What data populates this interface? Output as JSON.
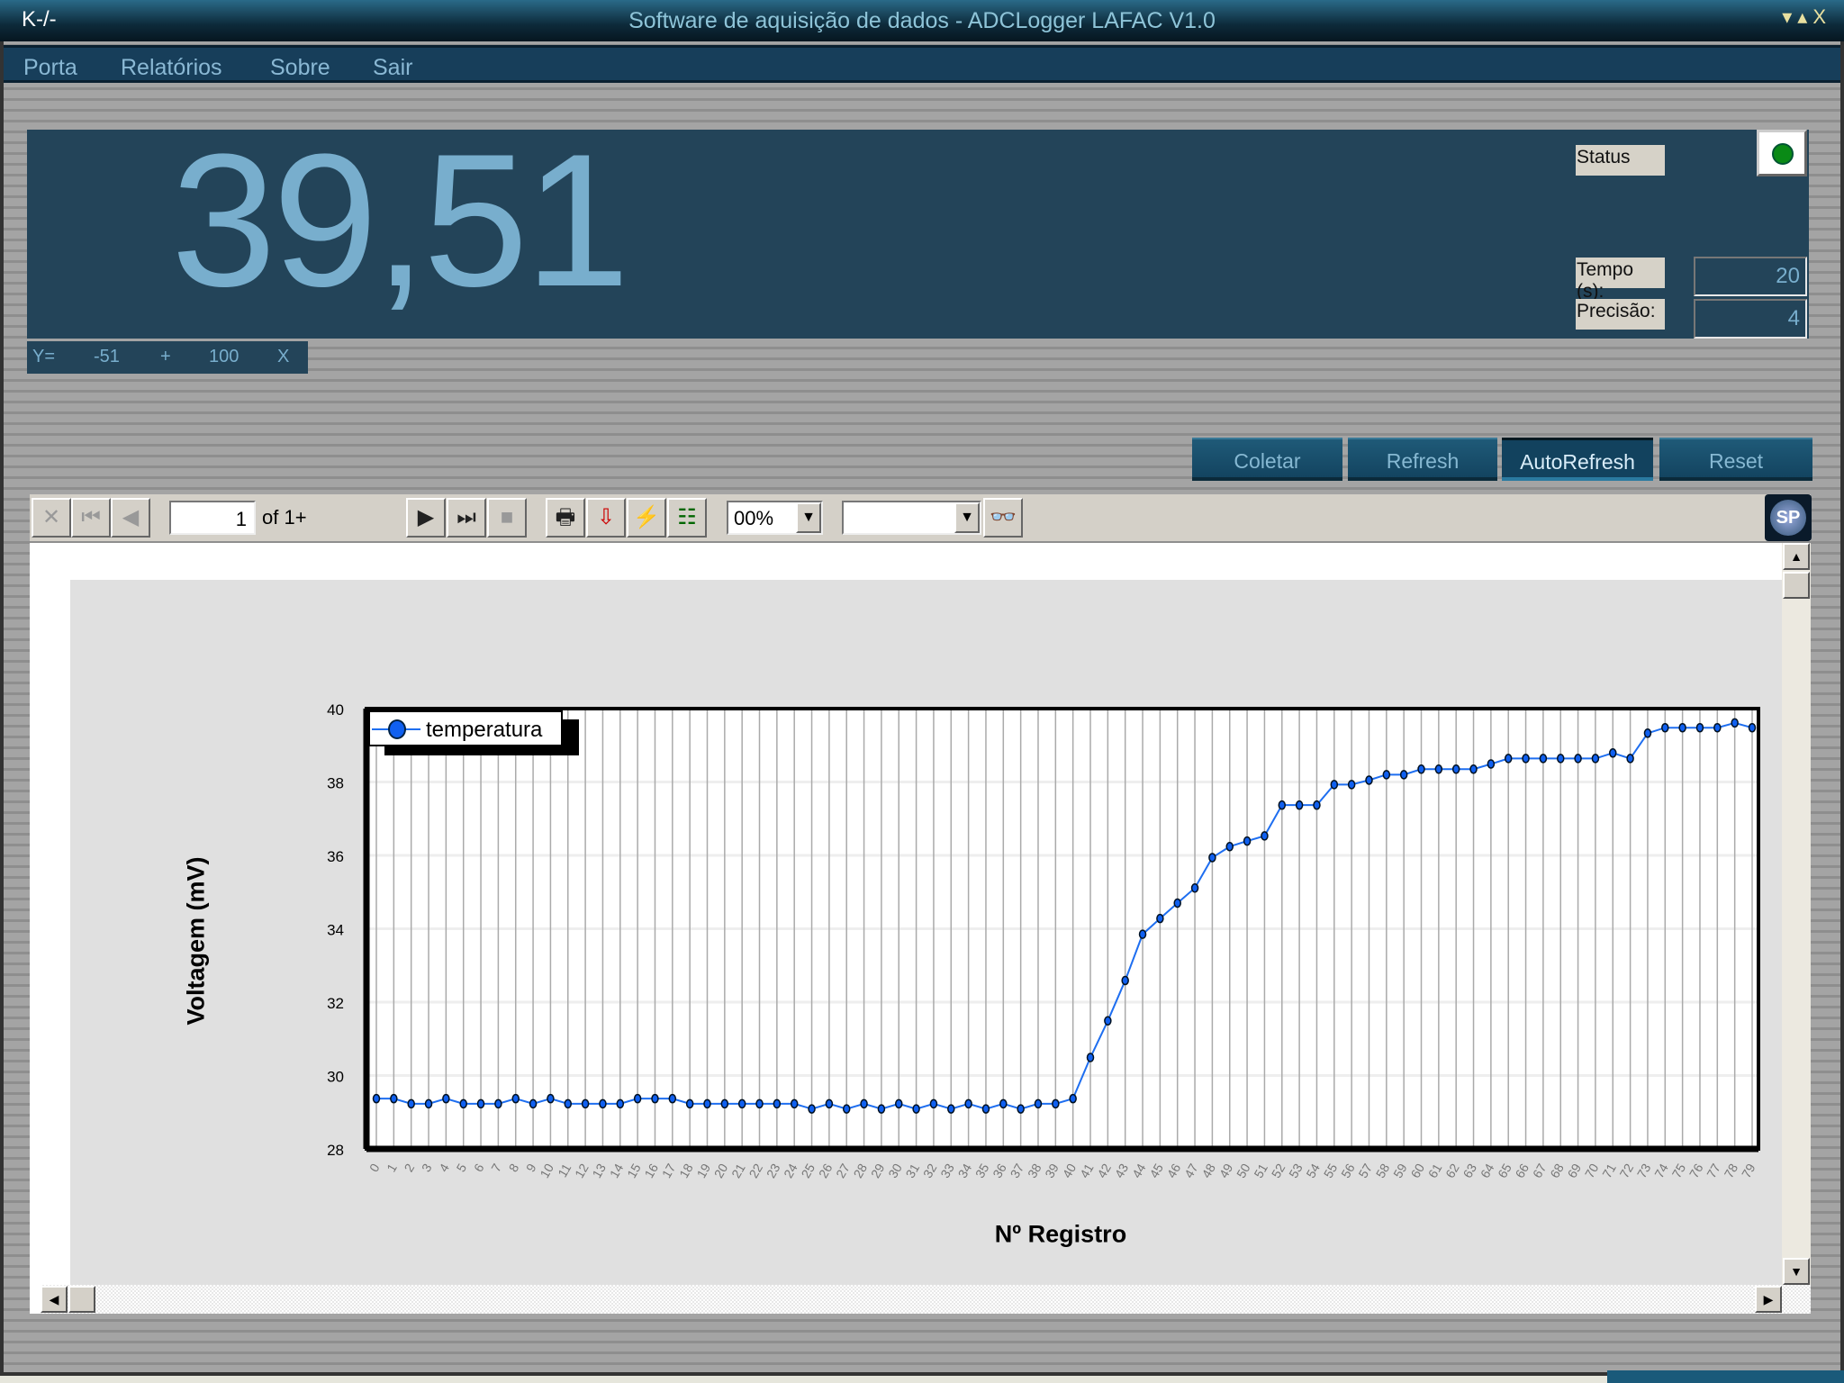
{
  "window": {
    "title": "Software de aquisição de dados - ADCLogger LAFAC V1.0",
    "app_icon": "K-/-",
    "controls": [
      "▾",
      "▴",
      "X"
    ]
  },
  "menu": [
    "Porta",
    "Relatórios",
    "Sobre",
    "Sair"
  ],
  "display": {
    "value": "39,51",
    "status_label": "Status",
    "status_color": "#0a8a16",
    "tempo_label": "Tempo (s):",
    "tempo_value": "20",
    "precisao_label": "Precisão:",
    "precisao_value": "4"
  },
  "formula": {
    "y": "Y=",
    "a": "-51",
    "op": "+",
    "b": "100",
    "x": "X"
  },
  "buttons": {
    "coletar": "Coletar",
    "refresh": "Refresh",
    "autorefresh": "AutoRefresh",
    "reset": "Reset"
  },
  "toolbar": {
    "page": "1",
    "of_pages": "of 1+",
    "zoom": "00%",
    "search": ""
  },
  "colors": {
    "panel": "#234459",
    "accent": "#78aecd",
    "series": "#1e6ef0"
  },
  "chart_data": {
    "type": "line",
    "xlabel": "Nº Registro",
    "ylabel": "Voltagem (mV)",
    "ylim": [
      28,
      40
    ],
    "yticks": [
      28,
      30,
      32,
      34,
      36,
      38,
      40
    ],
    "grid": "vertical lines per record, light horizontal lines per y tick",
    "legend_position": "top-left",
    "x": [
      0,
      1,
      2,
      3,
      4,
      5,
      6,
      7,
      8,
      9,
      10,
      11,
      12,
      13,
      14,
      15,
      16,
      17,
      18,
      19,
      20,
      21,
      22,
      23,
      24,
      25,
      26,
      27,
      28,
      29,
      30,
      31,
      32,
      33,
      34,
      35,
      36,
      37,
      38,
      39,
      40,
      41,
      42,
      43,
      44,
      45,
      46,
      47,
      48,
      49,
      50,
      51,
      52,
      53,
      54,
      55,
      56,
      57,
      58,
      59,
      60,
      61,
      62,
      63,
      64,
      65,
      66,
      67,
      68,
      69,
      70,
      71,
      72,
      73,
      74,
      75,
      76,
      77,
      78,
      79
    ],
    "series": [
      {
        "name": "temperatura",
        "values": [
          29.37,
          29.37,
          29.23,
          29.23,
          29.37,
          29.23,
          29.23,
          29.23,
          29.37,
          29.23,
          29.37,
          29.23,
          29.23,
          29.23,
          29.23,
          29.37,
          29.37,
          29.37,
          29.23,
          29.23,
          29.23,
          29.23,
          29.23,
          29.23,
          29.23,
          29.09,
          29.23,
          29.09,
          29.23,
          29.09,
          29.23,
          29.09,
          29.23,
          29.09,
          29.23,
          29.09,
          29.23,
          29.09,
          29.23,
          29.23,
          29.37,
          30.49,
          31.49,
          32.59,
          33.85,
          34.28,
          34.7,
          35.11,
          35.94,
          36.24,
          36.39,
          36.53,
          37.37,
          37.37,
          37.37,
          37.93,
          37.93,
          38.05,
          38.2,
          38.2,
          38.35,
          38.35,
          38.35,
          38.35,
          38.49,
          38.64,
          38.64,
          38.64,
          38.64,
          38.64,
          38.64,
          38.79,
          38.64,
          39.33,
          39.48,
          39.48,
          39.48,
          39.48,
          39.61,
          39.48
        ]
      }
    ]
  }
}
